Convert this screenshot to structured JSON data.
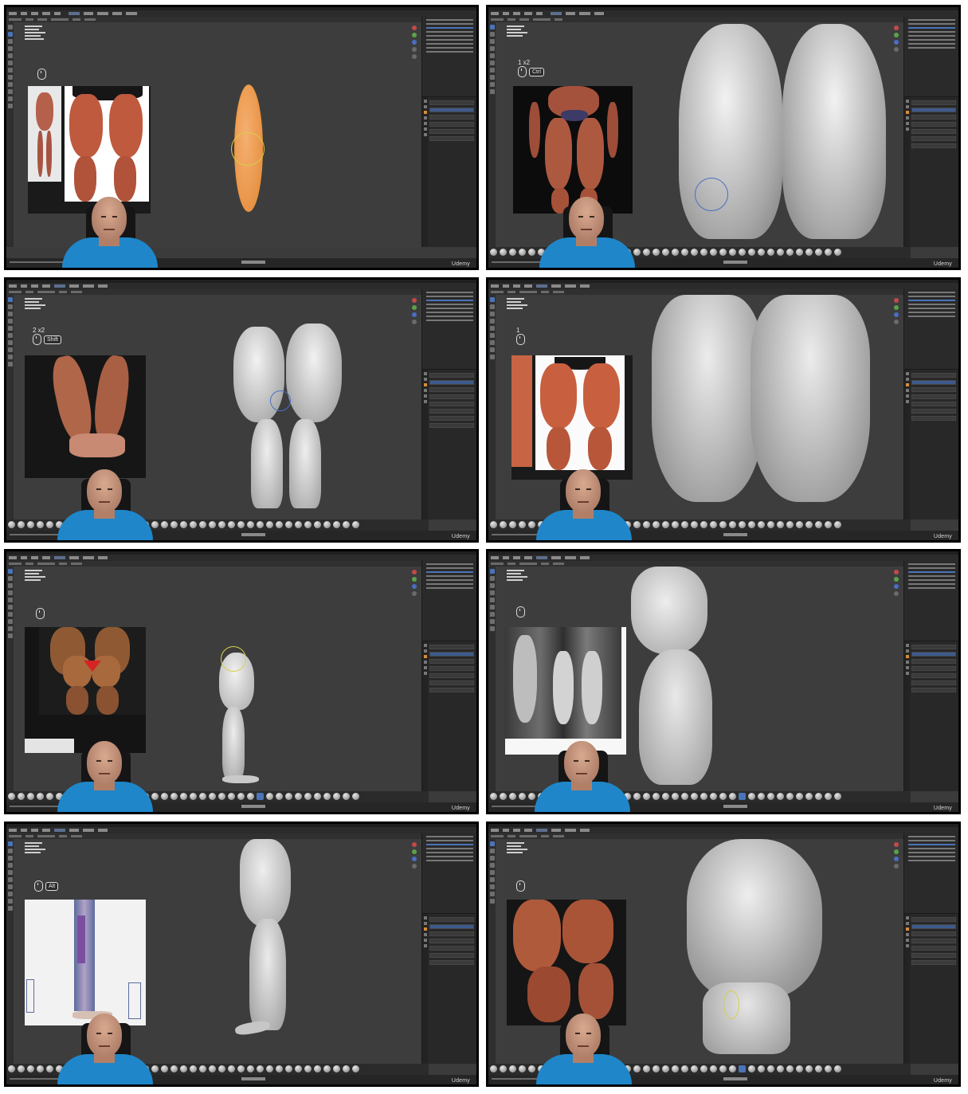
{
  "panels": [
    {
      "id": "p1",
      "mouse_hint": {
        "count": "",
        "key": ""
      },
      "udemy_logo": "Udemy"
    },
    {
      "id": "p2",
      "mouse_hint": {
        "count": "1 x2",
        "key": "Ctrl"
      },
      "udemy_logo": "Udemy"
    },
    {
      "id": "p3",
      "mouse_hint": {
        "count": "2 x2",
        "key": "Shift"
      },
      "udemy_logo": "Udemy"
    },
    {
      "id": "p4",
      "mouse_hint": {
        "count": "1",
        "key": ""
      },
      "udemy_logo": "Udemy"
    },
    {
      "id": "p5",
      "mouse_hint": {
        "count": "",
        "key": ""
      },
      "udemy_logo": "Udemy"
    },
    {
      "id": "p6",
      "mouse_hint": {
        "count": "",
        "key": ""
      },
      "udemy_logo": "Udemy"
    },
    {
      "id": "p7",
      "mouse_hint": {
        "count": "",
        "key": "Alt"
      },
      "udemy_logo": "Udemy"
    },
    {
      "id": "p8",
      "mouse_hint": {
        "count": "",
        "key": ""
      },
      "udemy_logo": "Udemy"
    }
  ],
  "colors": {
    "viewport_bg": "#3d3d3d",
    "panel_border": "#000000",
    "active_tool": "#4b73b8",
    "selection_orange": "#e8913a",
    "presenter_shirt": "#1f86c9",
    "brush_ring_yellow": "#d6d04a",
    "brush_ring_blue": "#4a6ec2"
  },
  "icons": {
    "mouse": "mouse-icon",
    "brush": "sculpt-brush-icon",
    "nav": "navigation-gizmo-icon"
  }
}
